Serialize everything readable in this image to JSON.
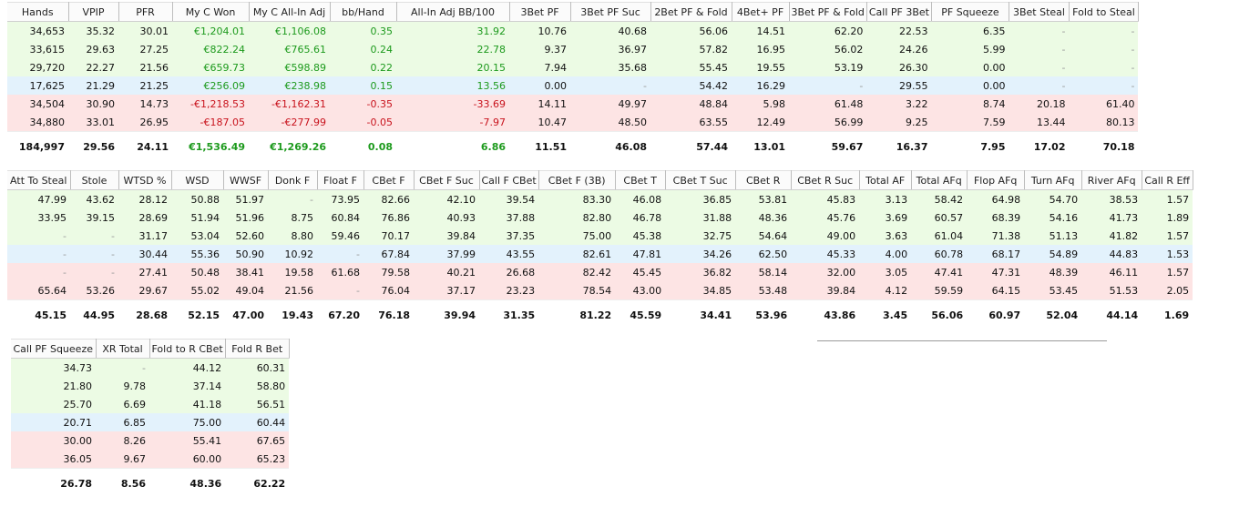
{
  "tables": [
    {
      "columns": [
        "Hands",
        "VPIP",
        "PFR",
        "My C Won",
        "My C All-In Adj",
        "bb/Hand",
        "All-In Adj BB/100",
        "3Bet PF",
        "3Bet PF Suc",
        "2Bet PF & Fold",
        "4Bet+ PF",
        "3Bet PF & Fold",
        "Call PF 3Bet",
        "PF Squeeze",
        "3Bet Steal",
        "Fold to Steal"
      ],
      "rows": [
        {
          "tone": "green",
          "cells": [
            "34,653",
            "35.32",
            "30.01",
            "€1,204.01",
            "€1,106.08",
            "0.35",
            "31.92",
            "10.76",
            "40.68",
            "56.06",
            "14.51",
            "62.20",
            "22.53",
            "6.35",
            "-",
            "-"
          ]
        },
        {
          "tone": "green",
          "cells": [
            "33,615",
            "29.63",
            "27.25",
            "€822.24",
            "€765.61",
            "0.24",
            "22.78",
            "9.37",
            "36.97",
            "57.82",
            "16.95",
            "56.02",
            "24.26",
            "5.99",
            "-",
            "-"
          ]
        },
        {
          "tone": "green",
          "cells": [
            "29,720",
            "22.27",
            "21.56",
            "€659.73",
            "€598.89",
            "0.22",
            "20.15",
            "7.94",
            "35.68",
            "55.45",
            "19.55",
            "53.19",
            "26.30",
            "0.00",
            "-",
            "-"
          ]
        },
        {
          "tone": "blue",
          "cells": [
            "17,625",
            "21.29",
            "21.25",
            "€256.09",
            "€238.98",
            "0.15",
            "13.56",
            "0.00",
            "-",
            "54.42",
            "16.29",
            "-",
            "29.55",
            "0.00",
            "-",
            "-"
          ]
        },
        {
          "tone": "pink",
          "cells": [
            "34,504",
            "30.90",
            "14.73",
            "-€1,218.53",
            "-€1,162.31",
            "-0.35",
            "-33.69",
            "14.11",
            "49.97",
            "48.84",
            "5.98",
            "61.48",
            "3.22",
            "8.74",
            "20.18",
            "61.40"
          ]
        },
        {
          "tone": "pink",
          "cells": [
            "34,880",
            "33.01",
            "26.95",
            "-€187.05",
            "-€277.99",
            "-0.05",
            "-7.97",
            "10.47",
            "48.50",
            "63.55",
            "12.49",
            "56.99",
            "9.25",
            "7.59",
            "13.44",
            "80.13"
          ]
        }
      ],
      "totals": [
        "184,997",
        "29.56",
        "24.11",
        "€1,536.49",
        "€1,269.26",
        "0.08",
        "6.86",
        "11.51",
        "46.08",
        "57.44",
        "13.01",
        "59.67",
        "16.37",
        "7.95",
        "17.02",
        "70.18"
      ]
    },
    {
      "columns": [
        "Att To Steal",
        "Stole",
        "WTSD %",
        "WSD",
        "WWSF",
        "Donk F",
        "Float F",
        "CBet F",
        "CBet F Suc",
        "Call F CBet",
        "CBet F (3B)",
        "CBet T",
        "CBet T Suc",
        "CBet R",
        "CBet R Suc",
        "Total AF",
        "Total AFq",
        "Flop AFq",
        "Turn AFq",
        "River AFq",
        "Call R Eff"
      ],
      "rows": [
        {
          "tone": "green",
          "cells": [
            "47.99",
            "43.62",
            "28.12",
            "50.88",
            "51.97",
            "-",
            "73.95",
            "82.66",
            "42.10",
            "39.54",
            "83.30",
            "46.08",
            "36.85",
            "53.81",
            "45.83",
            "3.13",
            "58.42",
            "64.98",
            "54.70",
            "38.53",
            "1.57"
          ]
        },
        {
          "tone": "green",
          "cells": [
            "33.95",
            "39.15",
            "28.69",
            "51.94",
            "51.96",
            "8.75",
            "60.84",
            "76.86",
            "40.93",
            "37.88",
            "82.80",
            "46.78",
            "31.88",
            "48.36",
            "45.76",
            "3.69",
            "60.57",
            "68.39",
            "54.16",
            "41.73",
            "1.89"
          ]
        },
        {
          "tone": "green",
          "cells": [
            "-",
            "-",
            "31.17",
            "53.04",
            "52.60",
            "8.80",
            "59.46",
            "70.17",
            "39.84",
            "37.35",
            "75.00",
            "45.38",
            "32.75",
            "54.64",
            "49.00",
            "3.63",
            "61.04",
            "71.38",
            "51.13",
            "41.82",
            "1.57"
          ]
        },
        {
          "tone": "blue",
          "cells": [
            "-",
            "-",
            "30.44",
            "55.36",
            "50.90",
            "10.92",
            "-",
            "67.84",
            "37.99",
            "43.55",
            "82.61",
            "47.81",
            "34.26",
            "62.50",
            "45.33",
            "4.00",
            "60.78",
            "68.17",
            "54.89",
            "44.83",
            "1.53"
          ]
        },
        {
          "tone": "pink",
          "cells": [
            "-",
            "-",
            "27.41",
            "50.48",
            "38.41",
            "19.58",
            "61.68",
            "79.58",
            "40.21",
            "26.68",
            "82.42",
            "45.45",
            "36.82",
            "58.14",
            "32.00",
            "3.05",
            "47.41",
            "47.31",
            "48.39",
            "46.11",
            "1.57"
          ]
        },
        {
          "tone": "pink",
          "cells": [
            "65.64",
            "53.26",
            "29.67",
            "55.02",
            "49.04",
            "21.56",
            "-",
            "76.04",
            "37.17",
            "23.23",
            "78.54",
            "43.00",
            "34.85",
            "53.48",
            "39.84",
            "4.12",
            "59.59",
            "64.15",
            "53.45",
            "51.53",
            "2.05"
          ]
        }
      ],
      "totals": [
        "45.15",
        "44.95",
        "28.68",
        "52.15",
        "47.00",
        "19.43",
        "67.20",
        "76.18",
        "39.94",
        "31.35",
        "81.22",
        "45.59",
        "34.41",
        "53.96",
        "43.86",
        "3.45",
        "56.06",
        "60.97",
        "52.04",
        "44.14",
        "1.69"
      ]
    },
    {
      "columns": [
        "Call PF Squeeze",
        "XR Total",
        "Fold to R CBet",
        "Fold R Bet"
      ],
      "rows": [
        {
          "tone": "green",
          "cells": [
            "34.73",
            "-",
            "44.12",
            "60.31"
          ]
        },
        {
          "tone": "green",
          "cells": [
            "21.80",
            "9.78",
            "37.14",
            "58.80"
          ]
        },
        {
          "tone": "green",
          "cells": [
            "25.70",
            "6.69",
            "41.18",
            "56.51"
          ]
        },
        {
          "tone": "blue",
          "cells": [
            "20.71",
            "6.85",
            "75.00",
            "60.44"
          ]
        },
        {
          "tone": "pink",
          "cells": [
            "30.00",
            "8.26",
            "55.41",
            "67.65"
          ]
        },
        {
          "tone": "pink",
          "cells": [
            "36.05",
            "9.67",
            "60.00",
            "65.23"
          ]
        }
      ],
      "totals": [
        "26.78",
        "8.56",
        "48.36",
        "62.22"
      ]
    }
  ],
  "colors": {
    "row_green": "#ecfbe4",
    "row_blue": "#e3f2fc",
    "row_pink": "#fde4e4",
    "positive_text": "#1d9a1d",
    "negative_text": "#c8121c"
  }
}
